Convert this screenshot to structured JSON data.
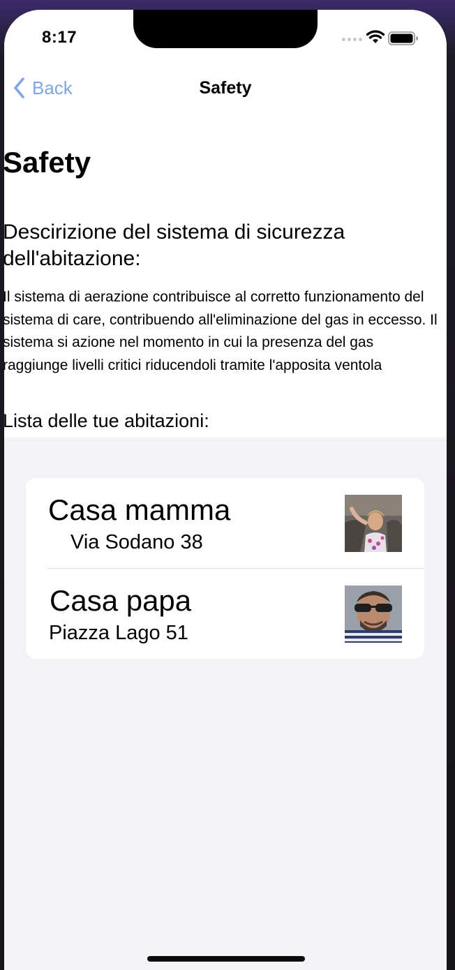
{
  "status_bar": {
    "time": "8:17"
  },
  "nav": {
    "back_label": "Back",
    "title": "Safety",
    "accent_color": "#7ba4ee"
  },
  "page": {
    "title": "Safety",
    "section_heading": "Descirizione del sistema di sicurezza dell'abitazione:",
    "description": "Il sistema di aerazione contribuisce al corretto funzionamento del sistema di care, contribuendo all'eliminazione del gas in eccesso. Il sistema si azione nel momento in cui la presenza del gas raggiunge livelli critici riducendoli tramite l'apposita ventola",
    "list_heading": "Lista delle tue abitazioni:"
  },
  "homes": [
    {
      "name": "Casa mamma",
      "address": "Via Sodano 38",
      "avatar": "photo-woman"
    },
    {
      "name": "Casa papa",
      "address": "Piazza Lago 51",
      "avatar": "photo-man-sunglasses"
    }
  ],
  "icons": {
    "back": "chevron-left-icon",
    "signal": "cellular-signal-icon",
    "wifi": "wifi-icon",
    "battery": "battery-icon"
  }
}
